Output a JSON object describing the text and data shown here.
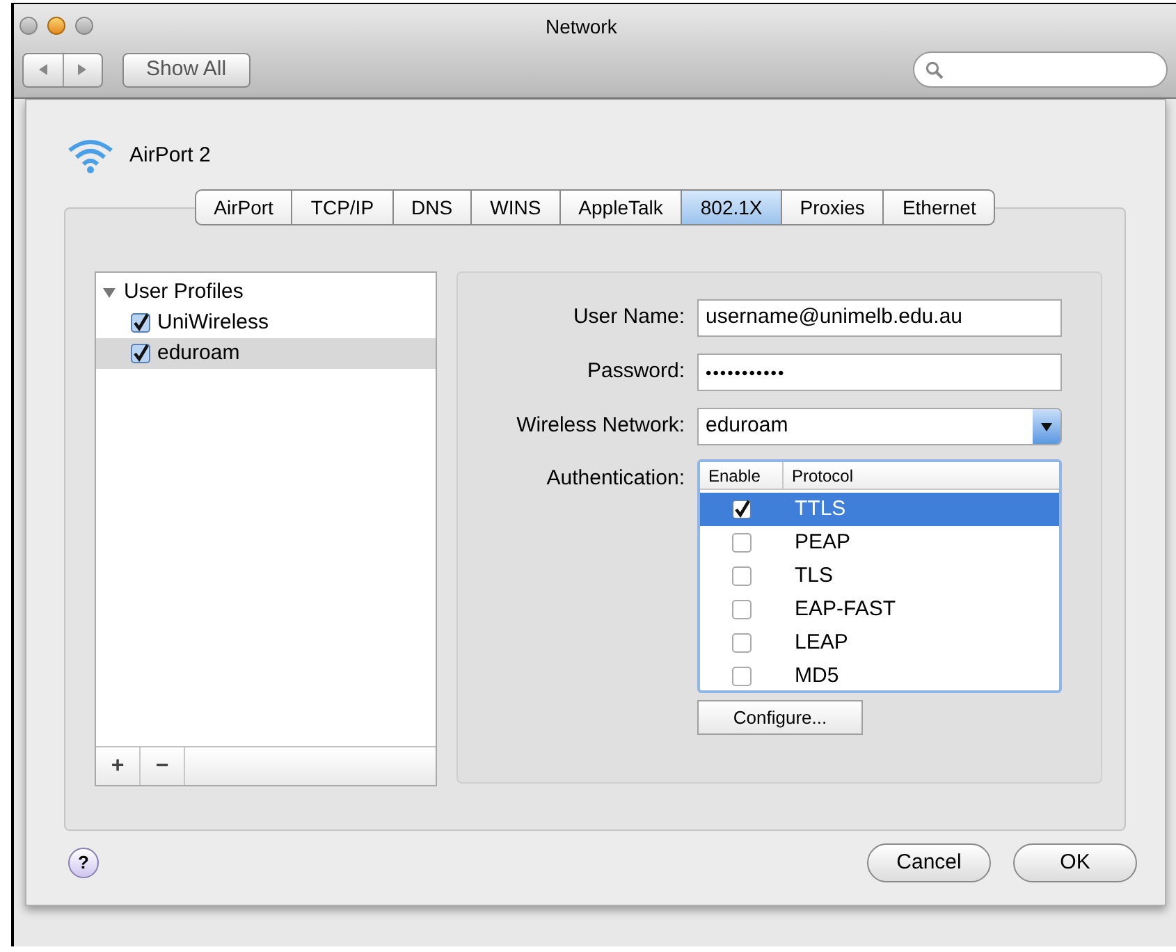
{
  "window": {
    "title": "Network"
  },
  "toolbar": {
    "show_all": "Show All"
  },
  "service": {
    "name": "AirPort 2"
  },
  "tabs": [
    {
      "label": "AirPort",
      "selected": false
    },
    {
      "label": "TCP/IP",
      "selected": false
    },
    {
      "label": "DNS",
      "selected": false
    },
    {
      "label": "WINS",
      "selected": false
    },
    {
      "label": "AppleTalk",
      "selected": false
    },
    {
      "label": "802.1X",
      "selected": true
    },
    {
      "label": "Proxies",
      "selected": false
    },
    {
      "label": "Ethernet",
      "selected": false
    }
  ],
  "profiles": {
    "label": "User Profiles",
    "expanded": true,
    "children": [
      {
        "label": "UniWireless",
        "checked": true,
        "selected": false
      },
      {
        "label": "eduroam",
        "checked": true,
        "selected": true
      }
    ]
  },
  "list_buttons": [
    "+",
    "−"
  ],
  "form": [
    {
      "kind": "text",
      "label": "User Name:",
      "value": "username@unimelb.edu.au"
    },
    {
      "kind": "password",
      "label": "Password:",
      "value": "•••••••••••"
    },
    {
      "kind": "popup",
      "label": "Wireless Network:",
      "value": "eduroam"
    }
  ],
  "authentication": {
    "label": "Authentication:",
    "columns": [
      "Enable",
      "Protocol"
    ],
    "rows": [
      {
        "protocol": "TTLS",
        "enabled": true,
        "selected": true
      },
      {
        "protocol": "PEAP",
        "enabled": false,
        "selected": false
      },
      {
        "protocol": "TLS",
        "enabled": false,
        "selected": false
      },
      {
        "protocol": "EAP-FAST",
        "enabled": false,
        "selected": false
      },
      {
        "protocol": "LEAP",
        "enabled": false,
        "selected": false
      },
      {
        "protocol": "MD5",
        "enabled": false,
        "selected": false
      }
    ]
  },
  "configure_button": "Configure...",
  "help_button": "?",
  "buttons": [
    "Cancel",
    "OK"
  ]
}
